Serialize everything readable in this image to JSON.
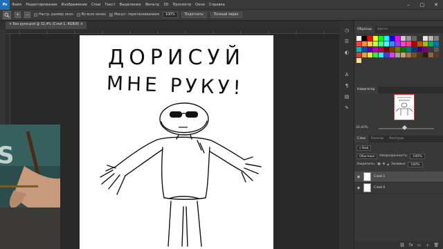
{
  "app": {
    "logo": "Ps",
    "brand_color": "#1d6fb8"
  },
  "menu": [
    "Файл",
    "Редактирование",
    "Изображение",
    "Слои",
    "Текст",
    "Выделение",
    "Фильтр",
    "3D",
    "Просмотр",
    "Окно",
    "Справка"
  ],
  "window_controls": {
    "minimize": "–",
    "maximize": "▢",
    "close": "✕"
  },
  "options": {
    "resize_windows": "Настр. размер окон",
    "all_windows": "Во всех окнах",
    "scrubby_zoom": "Масшт. перетаскиванием",
    "zoom_value": "100%",
    "fit_screen": "Подогнать",
    "fill_screen": "Полный экран"
  },
  "document_tab": "× Без руки.psd @ 32,4% (Слой 1, RGB/8) ×",
  "drawing": {
    "title_line1": "ДОРИСУЙ",
    "title_line2": "МНЕ РУКУ!"
  },
  "panels": {
    "swatches_tabs": [
      "Образцы",
      "Кисти"
    ],
    "navigator_tab": "Навигатор",
    "zoom_level": "32,42%",
    "layers_tabs": [
      "Слои",
      "Каналы",
      "Контуры"
    ],
    "kind_filter": "Вид",
    "blend_mode": "Обычные",
    "opacity_label": "Непрозрачность:",
    "opacity_value": "100%",
    "lock_label": "Закрепить:",
    "fill_label": "Заливка:",
    "fill_value": "100%",
    "layers": [
      {
        "name": "Слой 1",
        "active": true
      },
      {
        "name": "Слой 0",
        "active": false
      }
    ]
  },
  "swatch_colors": [
    [
      "#ffffff",
      "#000000",
      "#ff0000",
      "#ffff00",
      "#00ff00",
      "#00ffff",
      "#0000ff",
      "#ff00ff",
      "#c8c8c8",
      "#969696",
      "#646464",
      "#323232",
      "#e6e6e6",
      "#b4b4b4",
      "#7d7d7d"
    ],
    [
      "#ff3c3c",
      "#ff8c3c",
      "#ffd23c",
      "#c8ff3c",
      "#3cff8c",
      "#3cffff",
      "#3c8cff",
      "#8c3cff",
      "#ff3cd2",
      "#ff3c8c",
      "#b40000",
      "#b45a00",
      "#b4b400",
      "#00b45a",
      "#0078b4"
    ],
    [
      "#00b4b4",
      "#0050b4",
      "#5a00b4",
      "#b400b4",
      "#b40050",
      "#780000",
      "#783c00",
      "#787800",
      "#007800",
      "#007878",
      "#003c78",
      "#3c0078",
      "#780078",
      "#3c3c3c",
      "#5a5a5a"
    ],
    [
      "#d23c3c",
      "#e6a03c",
      "#e6e63c",
      "#3ce63c",
      "#3ce6e6",
      "#3c3ce6",
      "#e63ce6",
      "#a0a0a0",
      "#c8a078",
      "#a07850",
      "#785028",
      "#503214",
      "#281e0a",
      "#8c6446",
      "#5a3c28"
    ],
    [
      "#ffe68c"
    ]
  ]
}
